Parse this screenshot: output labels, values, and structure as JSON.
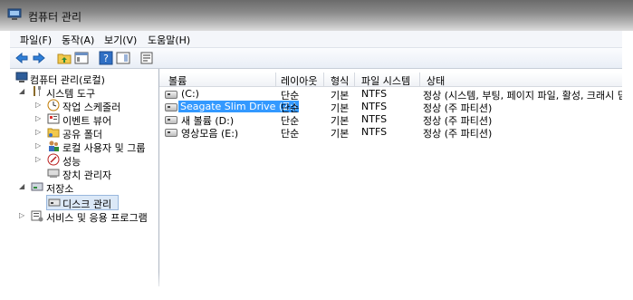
{
  "window": {
    "title": "컴퓨터 관리"
  },
  "menu": [
    "파일(F)",
    "동작(A)",
    "보기(V)",
    "도움말(H)"
  ],
  "toolbar": [
    "back-arrow-icon",
    "forward-arrow-icon",
    "up-folder-icon",
    "properties-icon",
    "help-icon",
    "show-hide-pane-icon",
    "refresh-icon"
  ],
  "tree": [
    {
      "label": "컴퓨터 관리(로컬)",
      "icon": "computer-management-icon",
      "expander": ""
    },
    {
      "label": "시스템 도구",
      "icon": "tools-icon",
      "expander": "◢"
    },
    {
      "label": "작업 스케줄러",
      "icon": "clock-icon",
      "expander": "▷"
    },
    {
      "label": "이벤트 뷰어",
      "icon": "event-viewer-icon",
      "expander": "▷"
    },
    {
      "label": "공유 폴더",
      "icon": "shared-folder-icon",
      "expander": "▷"
    },
    {
      "label": "로컬 사용자 및 그룹",
      "icon": "users-icon",
      "expander": "▷"
    },
    {
      "label": "성능",
      "icon": "performance-icon",
      "expander": "▷"
    },
    {
      "label": "장치 관리자",
      "icon": "device-manager-icon",
      "expander": ""
    },
    {
      "label": "저장소",
      "icon": "storage-icon",
      "expander": "◢"
    },
    {
      "label": "디스크 관리",
      "icon": "disk-management-icon",
      "expander": ""
    },
    {
      "label": "서비스 및 응용 프로그램",
      "icon": "services-icon",
      "expander": "▷"
    }
  ],
  "columns": [
    "볼륨",
    "레이아웃",
    "형식",
    "파일 시스템",
    "상태"
  ],
  "volumes": [
    {
      "name": "(C:)",
      "layout": "단순",
      "type": "기본",
      "fs": "NTFS",
      "status": "정상 (시스템, 부팅, 페이지 파일, 활성, 크래시 덤"
    },
    {
      "name": "Seagate Slim Drive (Z:)",
      "layout": "단순",
      "type": "기본",
      "fs": "NTFS",
      "status": "정상 (주 파티션)"
    },
    {
      "name": "새 볼륨 (D:)",
      "layout": "단순",
      "type": "기본",
      "fs": "NTFS",
      "status": "정상 (주 파티션)"
    },
    {
      "name": "영상모음 (E:)",
      "layout": "단순",
      "type": "기본",
      "fs": "NTFS",
      "status": "정상 (주 파티션)"
    }
  ],
  "colors": {
    "selection": "#3399ff",
    "tree_selection": "#dbe8f7",
    "titlebar": "#8a8a8a"
  }
}
